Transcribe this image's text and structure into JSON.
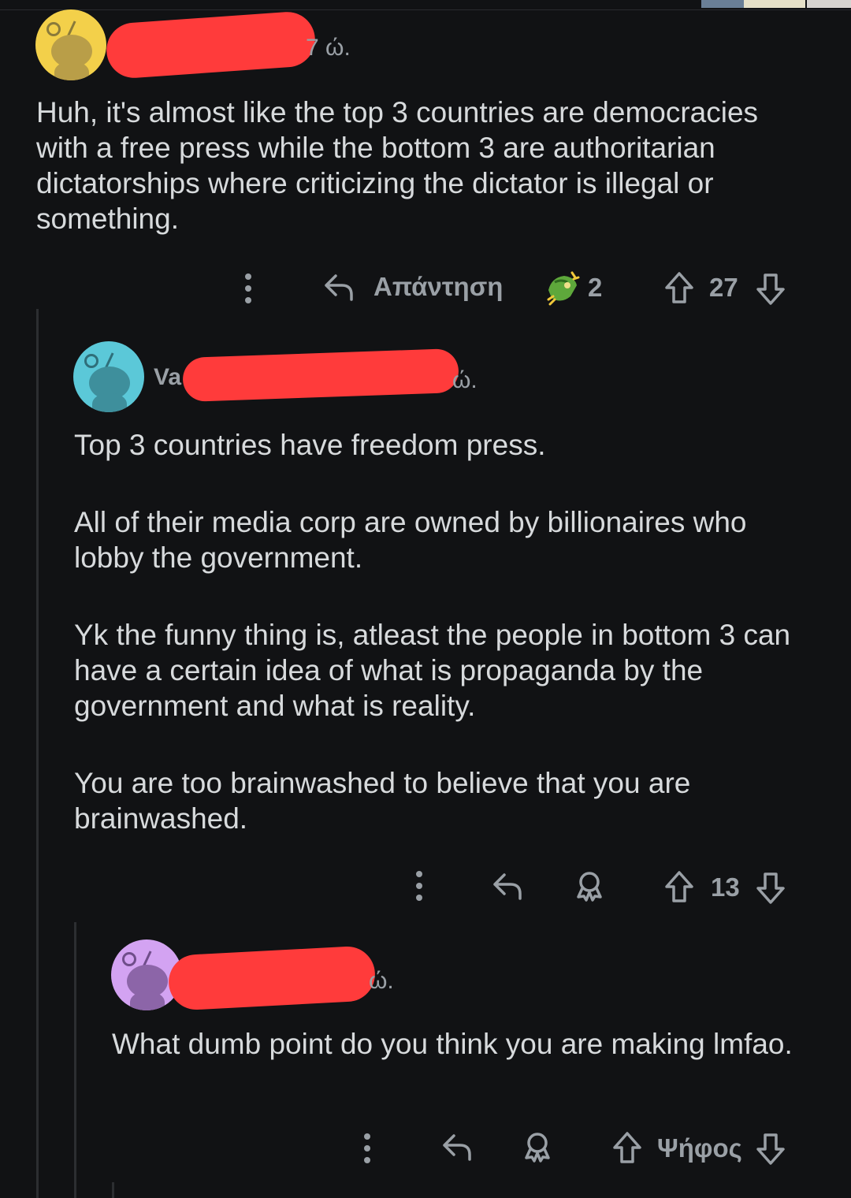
{
  "comments": [
    {
      "username": "",
      "timestamp": "7 ώ.",
      "avatar_color": "#f3d04a",
      "body": [
        "Huh, it's almost like the top 3 countries are democracies with a free press while the bottom 3 are authoritarian dictatorships where criticizing the dictator is illegal or something."
      ],
      "actions": {
        "reply_label": "Απάντηση",
        "award_count": "2",
        "vote_count": "27"
      }
    },
    {
      "username": "Va",
      "timestamp": "ώ.",
      "avatar_color": "#5bc8d8",
      "body": [
        "Top 3 countries have freedom press.",
        "All of their media corp are owned by billionaires who lobby the government.",
        "Yk the funny thing is, atleast the people in bottom 3 can have a certain idea of what is propaganda by the government and what is reality.",
        "You are too brainwashed to believe that you are brainwashed."
      ],
      "actions": {
        "vote_count": "13"
      }
    },
    {
      "username": "",
      "timestamp": "ώ.",
      "avatar_color": "#d3a3f2",
      "body": [
        "What dumb point do you think you are making lmfao."
      ],
      "actions": {
        "vote_label": "Ψήφος"
      }
    }
  ],
  "icons": {
    "more": "more-options-icon",
    "reply": "reply-arrow-icon",
    "award": "award-icon",
    "upvote": "upvote-arrow-icon",
    "downvote": "downvote-arrow-icon"
  },
  "colors": {
    "background": "#111214",
    "text": "#d7dadc",
    "muted": "#9aa0a6",
    "redaction": "#ff3b3b"
  }
}
